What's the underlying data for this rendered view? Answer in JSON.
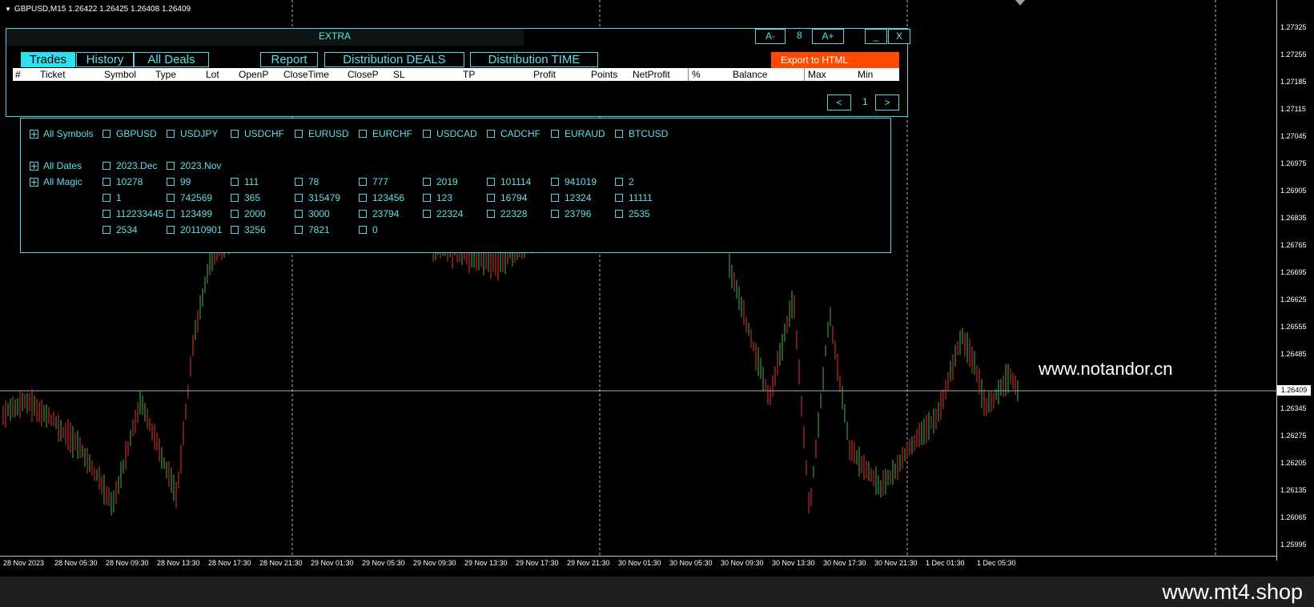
{
  "chart": {
    "symbol_header": "GBPUSD,M15  1.26422 1.26425 1.26408 1.26409",
    "current_price": "1.26409",
    "price_labels": [
      "1.27325",
      "1.27255",
      "1.27185",
      "1.27115",
      "1.27045",
      "1.26975",
      "1.26905",
      "1.26835",
      "1.26765",
      "1.26695",
      "1.26625",
      "1.26555",
      "1.26485",
      "1.26345",
      "1.26275",
      "1.26205",
      "1.26135",
      "1.26065",
      "1.25995"
    ],
    "time_labels": [
      "28 Nov 2023",
      "28 Nov 05:30",
      "28 Nov 09:30",
      "28 Nov 13:30",
      "28 Nov 17:30",
      "28 Nov 21:30",
      "29 Nov 01:30",
      "29 Nov 05:30",
      "29 Nov 09:30",
      "29 Nov 13:30",
      "29 Nov 17:30",
      "29 Nov 21:30",
      "30 Nov 01:30",
      "30 Nov 05:30",
      "30 Nov 09:30",
      "30 Nov 13:30",
      "30 Nov 17:30",
      "30 Nov 21:30",
      "1 Dec 01:30",
      "1 Dec 05:30"
    ],
    "watermark": "www.notandor.cn",
    "bull_color": "#4caf50",
    "bear_color": "#e53935"
  },
  "footer": {
    "brand": "www.mt4.shop"
  },
  "panel": {
    "title": "EXTRA",
    "font_down": "A-",
    "font_size": "8",
    "font_up": "A+",
    "minimize": "_",
    "close": "X",
    "tabs": [
      "Trades",
      "History",
      "All Deals",
      "Report",
      "Distribution DEALS",
      "Distribution TIME"
    ],
    "export_label": "Export to HTML",
    "columns": [
      "#",
      "Ticket",
      "Symbol",
      "Type",
      "Lot",
      "OpenP",
      "CloseTime",
      "CloseP",
      "SL",
      "TP",
      "Profit",
      "Points",
      "NetProfit",
      "%",
      "Balance",
      "Max",
      "Min"
    ],
    "pager_prev": "<",
    "pager_page": "1",
    "pager_next": ">"
  },
  "filters": {
    "symbols_label": "All Symbols",
    "symbols": [
      "GBPUSD",
      "USDJPY",
      "USDCHF",
      "EURUSD",
      "EURCHF",
      "USDCAD",
      "CADCHF",
      "EURAUD",
      "BTCUSD"
    ],
    "dates_label": "All Dates",
    "dates": [
      "2023.Dec",
      "2023.Nov"
    ],
    "magic_label": "All Magic",
    "magic": [
      "10278",
      "99",
      "111",
      "78",
      "777",
      "2019",
      "101114",
      "941019",
      "2",
      "1",
      "742569",
      "365",
      "315479",
      "123456",
      "123",
      "16794",
      "12324",
      "11111",
      "112233445",
      "123499",
      "2000",
      "3000",
      "23794",
      "22324",
      "22328",
      "23796",
      "2535",
      "2534",
      "20110901",
      "3256",
      "7821",
      "0"
    ]
  }
}
